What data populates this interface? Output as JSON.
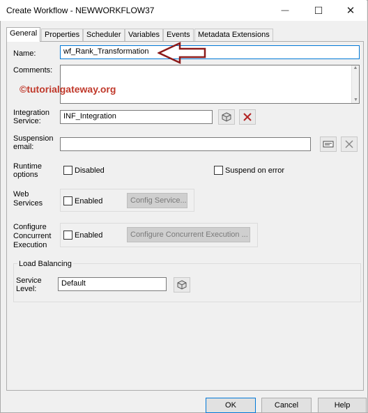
{
  "window": {
    "title": "Create Workflow - NEWWORKFLOW37",
    "minimize_glyph": "—",
    "maximize_glyph": "☐",
    "close_glyph": "✕"
  },
  "tabs": [
    {
      "label": "General",
      "active": true
    },
    {
      "label": "Properties"
    },
    {
      "label": "Scheduler"
    },
    {
      "label": "Variables"
    },
    {
      "label": "Events"
    },
    {
      "label": "Metadata Extensions"
    }
  ],
  "form": {
    "name_label": "Name:",
    "name_value": "wf_Rank_Transformation",
    "comments_label": "Comments:",
    "comments_value": "",
    "watermark": "©tutorialgateway.org",
    "integration_label_1": "Integration",
    "integration_label_2": "Service:",
    "integration_value": "INF_Integration",
    "suspension_label_1": "Suspension",
    "suspension_label_2": "email:",
    "suspension_value": "",
    "runtime_label_1": "Runtime",
    "runtime_label_2": "options",
    "disabled_label": "Disabled",
    "suspend_label": "Suspend on error",
    "web_label_1": "Web",
    "web_label_2": "Services",
    "web_enabled_label": "Enabled",
    "config_service_label": "Config Service...",
    "concurrent_label_1": "Configure",
    "concurrent_label_2": "Concurrent",
    "concurrent_label_3": "Execution",
    "concurrent_enabled_label": "Enabled",
    "configure_concurrent_label": "Configure Concurrent Execution ...",
    "load_balancing_title": "Load Balancing",
    "service_level_label_1": "Service",
    "service_level_label_2": "Level:",
    "service_level_value": "Default"
  },
  "buttons": {
    "ok": "OK",
    "cancel": "Cancel",
    "help": "Help"
  },
  "colors": {
    "focus_border": "#0078d7",
    "arrow": "#8b1a1a",
    "watermark": "#c0392b",
    "delete_x": "#b22222"
  }
}
